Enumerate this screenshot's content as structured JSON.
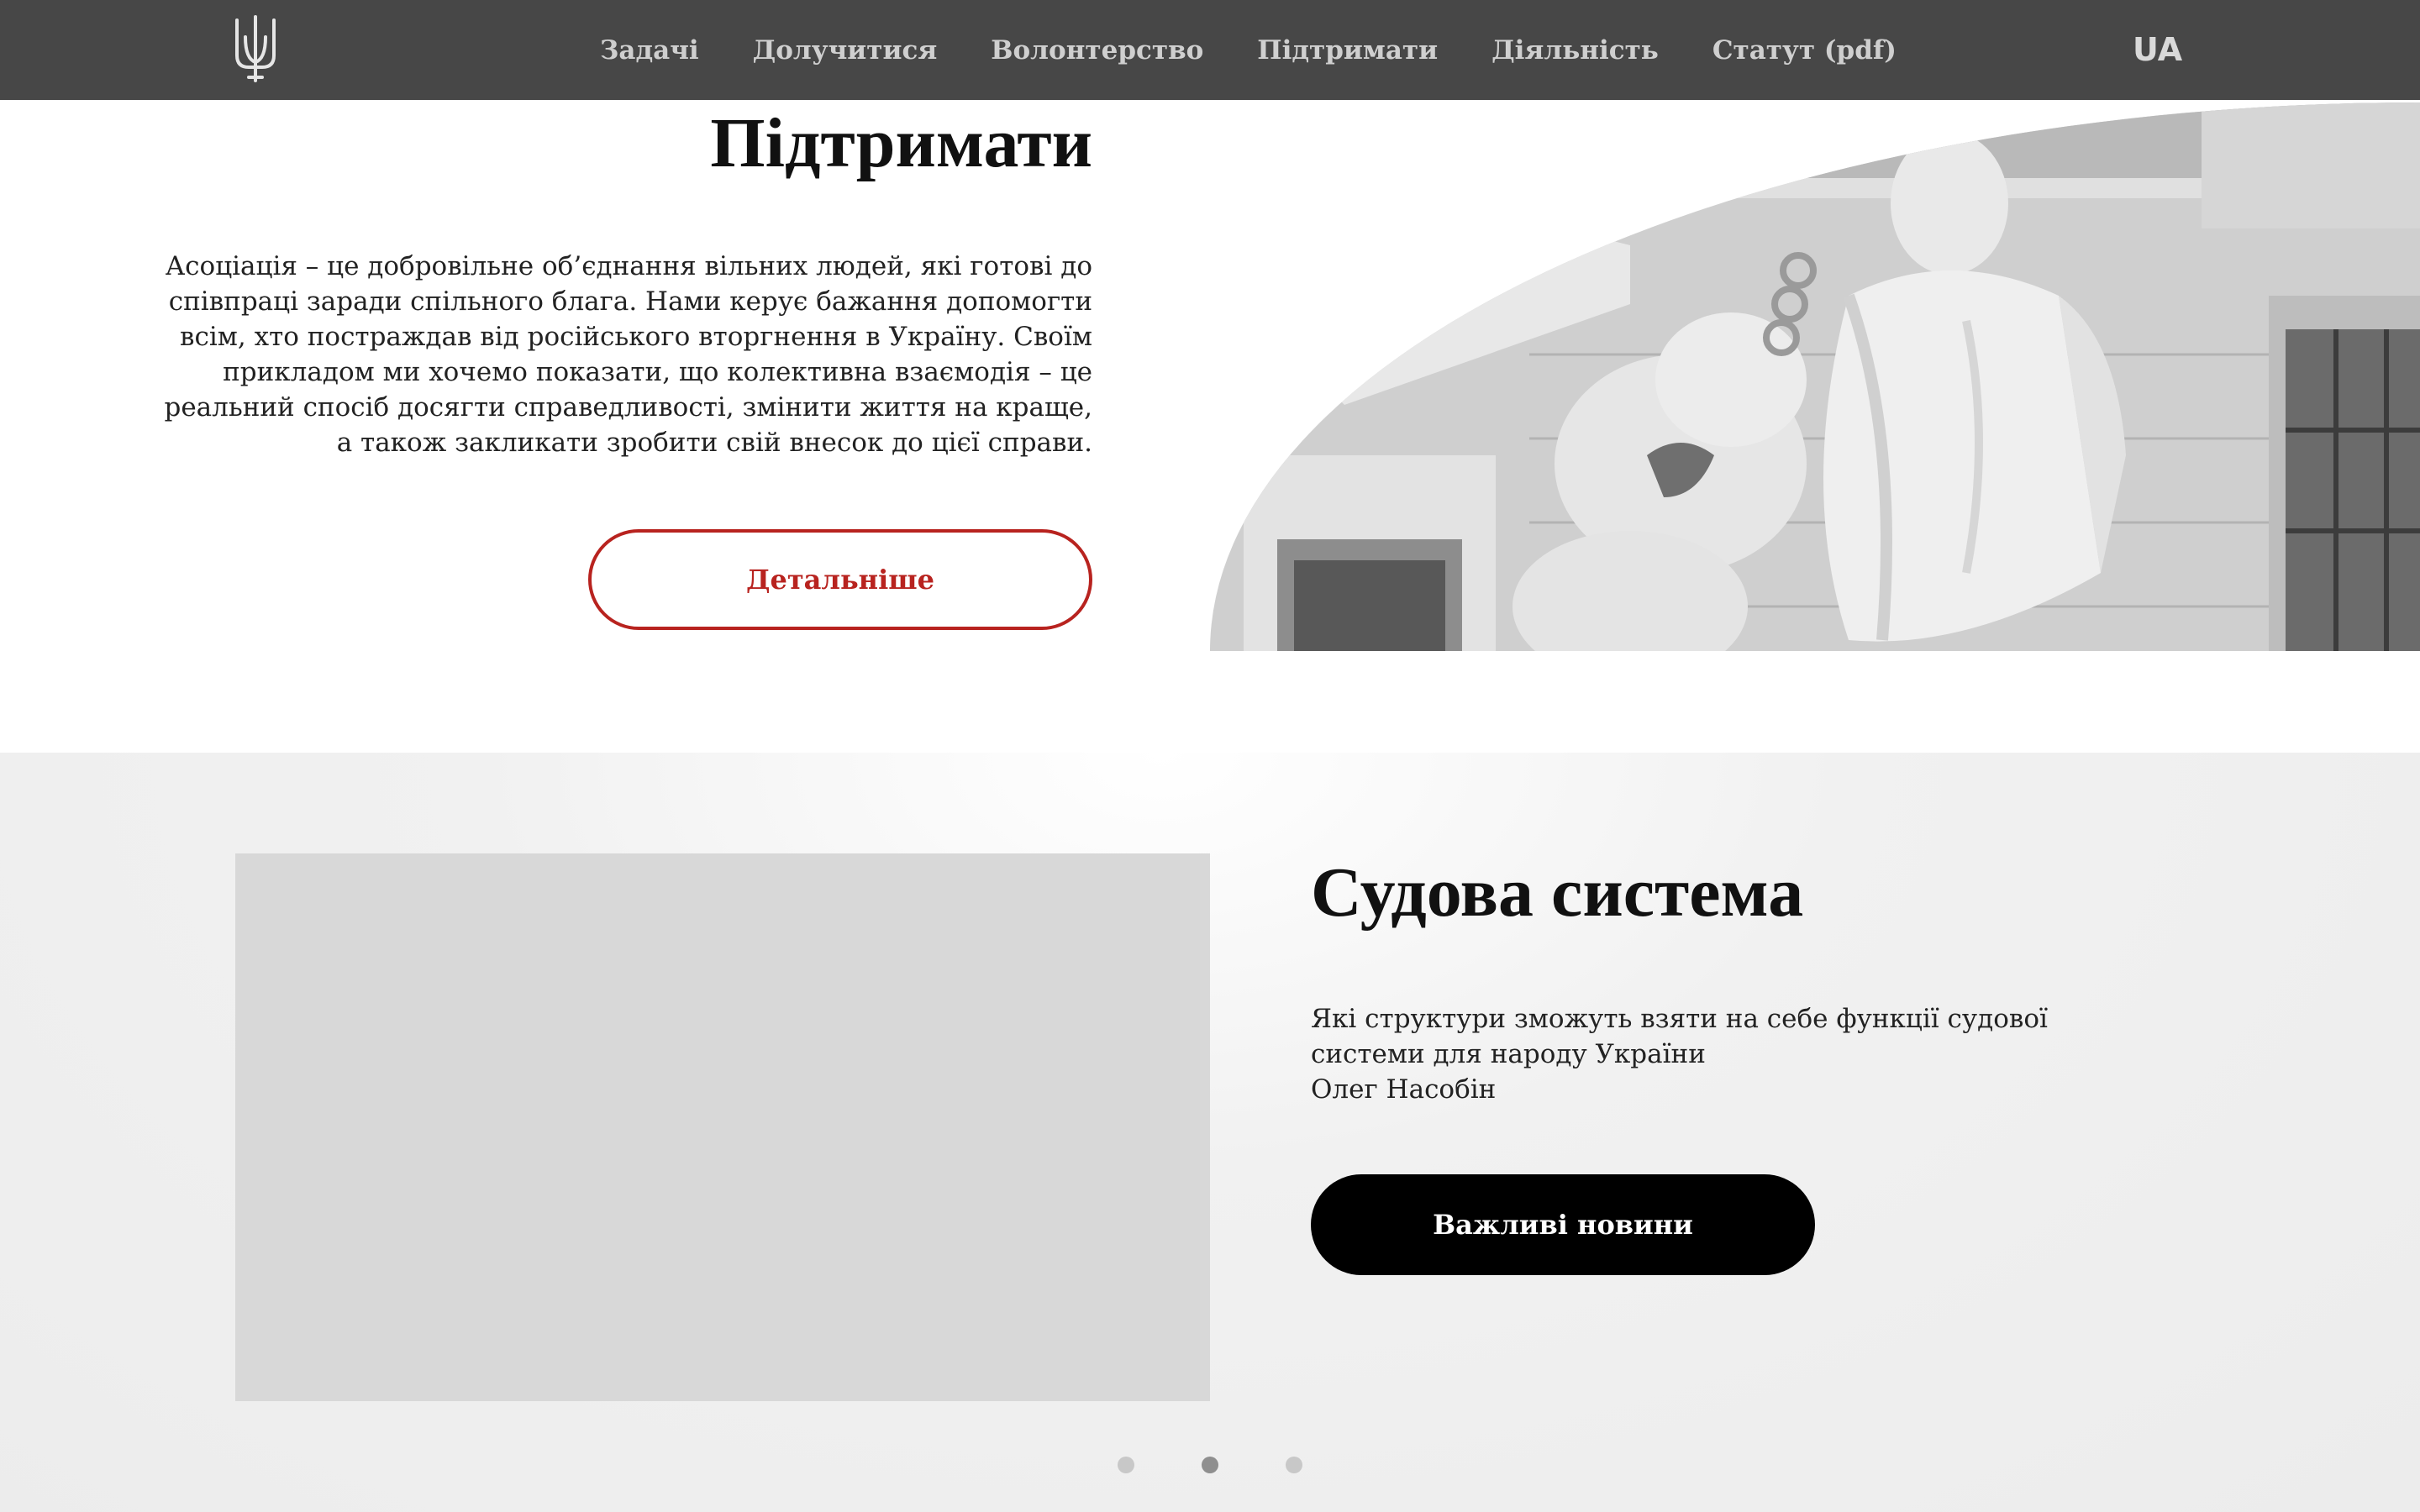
{
  "nav": {
    "logo_icon": "trident-icon",
    "items": [
      {
        "label": "Задачі"
      },
      {
        "label": "Долучитися"
      },
      {
        "label": "Волонтерство"
      },
      {
        "label": "Підтримати"
      },
      {
        "label": "Діяльність"
      },
      {
        "label": "Статут (pdf)"
      }
    ],
    "language": "UA"
  },
  "support": {
    "title": "Підтримати",
    "text": "Асоціація – це добровільне об’єднання вільних людей, які готові до співпраці заради спільного блага. Нами керує бажання допомогти всім, хто постраждав від російського вторгнення в Україну. Своїм прикладом ми хочемо показати, що колективна взаємодія – це реальний спосіб досягти справедливості, змінити життя на краще, а також закликати зробити свій внесок до цієї справи.",
    "button_label": "Детальніше",
    "image": "statue-photo"
  },
  "news": {
    "title": "Судова система",
    "text": "Які структури зможуть взяти на себе функції судової системи для народу України",
    "author": "Олег Насобін",
    "button_label": "Важливі новини",
    "slides_total": 3,
    "active_slide": 2
  },
  "colors": {
    "navbar": "#474747",
    "accent_red": "#b8231f",
    "news_button": "#000000",
    "news_background": "#f1f1f1",
    "placeholder": "#d8d8d8"
  }
}
